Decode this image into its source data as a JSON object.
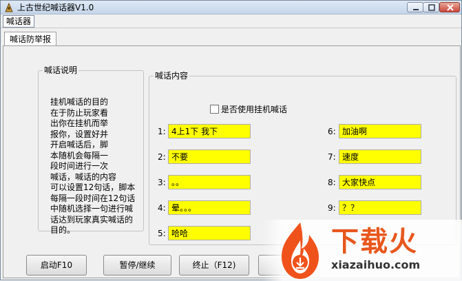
{
  "window": {
    "title": "上古世纪喊话器V1.0"
  },
  "menu": {
    "item": "喊话器"
  },
  "tab": {
    "label": "喊话防举报"
  },
  "description_group": {
    "title": "喊话说明",
    "text": "挂机喊话的目的\n在于防止玩家看\n出你在挂机而举\n报你，设置好并\n开启喊话后，脚\n本随机会每隔一\n段时间进行一次\n喊话，喊话的内容\n可以设置12句话，脚本\n每隔一段时间在12句话\n中随机选择一句进行喊\n话达到玩家真实喊话的\n目的。"
  },
  "content_group": {
    "title": "喊话内容",
    "use_checkbox_label": "是否使用挂机喊话",
    "left_items": [
      {
        "num": "1:",
        "value": "4上1下 我下"
      },
      {
        "num": "2:",
        "value": "不要"
      },
      {
        "num": "3:",
        "value": "。。"
      },
      {
        "num": "4:",
        "value": "晕。。。"
      },
      {
        "num": "5:",
        "value": "哈哈"
      }
    ],
    "right_items": [
      {
        "num": "6:",
        "value": "加油啊"
      },
      {
        "num": "7:",
        "value": "速度"
      },
      {
        "num": "8:",
        "value": "大家快点"
      },
      {
        "num": "9:",
        "value": "？？"
      }
    ]
  },
  "buttons": {
    "start": "启动F10",
    "pause": "暂停/继续",
    "stop": "终止（F12)"
  },
  "watermark": {
    "brand": "下载火",
    "url": "xiazaihuo.com"
  },
  "colors": {
    "field_bg": "#ffff00",
    "watermark_orange": "#e8571d"
  }
}
